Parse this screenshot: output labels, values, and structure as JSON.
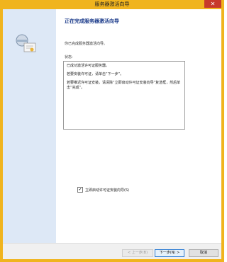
{
  "window": {
    "title": "服务器激活向导",
    "close_symbol": "✕"
  },
  "page": {
    "heading": "正在完成服务器激活向导",
    "description": "你已完成服务器激活向导。",
    "status_label": "状态:",
    "status_lines": [
      "已成功激活许可证服务器。",
      "若要安装许可证，请单击“下一步”。",
      "若要推迟许可证安装，请清除“立即启动许可证安装向导”复选框，然后单击“完成”。"
    ],
    "checkbox_label": "立即启动许可证安装向导(S)",
    "checkbox_checked": true,
    "checkmark": "✔"
  },
  "buttons": {
    "back": "< 上一步(B)",
    "next": "下一步(N) >",
    "cancel": "取消"
  }
}
